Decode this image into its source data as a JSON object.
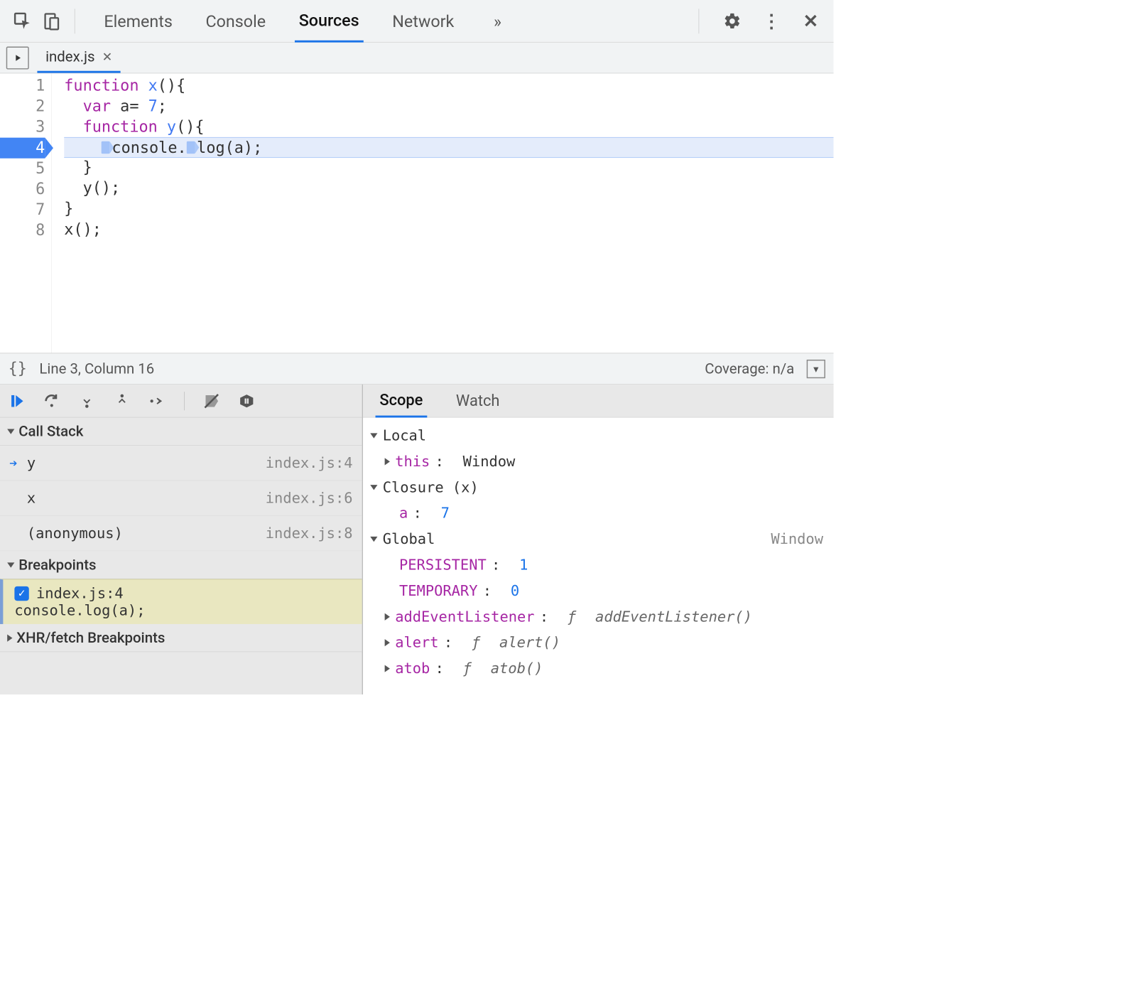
{
  "topTabs": {
    "elements": "Elements",
    "console": "Console",
    "sources": "Sources",
    "network": "Network"
  },
  "fileTab": {
    "name": "index.js"
  },
  "code": {
    "lines": [
      {
        "n": "1"
      },
      {
        "n": "2"
      },
      {
        "n": "3"
      },
      {
        "n": "4",
        "current": true
      },
      {
        "n": "5"
      },
      {
        "n": "6"
      },
      {
        "n": "7"
      },
      {
        "n": "8"
      }
    ],
    "kw_function1": "function",
    "kw_function2": "function",
    "kw_var": "var",
    "fn_x": "x",
    "fn_y": "y",
    "obj_console": "console",
    "method_log": "log",
    "arg_a": "a",
    "lit_7": "7",
    "decl_a": "a",
    "close_brace": "}",
    "call_y": "y();",
    "call_x": "x();"
  },
  "status": {
    "braces": "{}",
    "pos": "Line 3, Column 16",
    "coverage": "Coverage: n/a"
  },
  "sections": {
    "callstack": "Call Stack",
    "breakpoints": "Breakpoints",
    "xhr": "XHR/fetch Breakpoints"
  },
  "callstack": [
    {
      "name": "y",
      "loc": "index.js:4",
      "current": true
    },
    {
      "name": "x",
      "loc": "index.js:6",
      "current": false
    },
    {
      "name": "(anonymous)",
      "loc": "index.js:8",
      "current": false
    }
  ],
  "breakpoints": [
    {
      "label": "index.js:4",
      "code": "console.log(a);",
      "checked": true
    }
  ],
  "rightTabs": {
    "scope": "Scope",
    "watch": "Watch"
  },
  "scope": {
    "local": {
      "label": "Local",
      "this_key": "this",
      "this_val": "Window"
    },
    "closure": {
      "label": "Closure (x)",
      "a_key": "a",
      "a_val": "7"
    },
    "global": {
      "label": "Global",
      "right": "Window",
      "persistent_key": "PERSISTENT",
      "persistent_val": "1",
      "temporary_key": "TEMPORARY",
      "temporary_val": "0",
      "ael_key": "addEventListener",
      "ael_val_f": "ƒ",
      "ael_val_name": "addEventListener()",
      "alert_key": "alert",
      "alert_val_f": "ƒ",
      "alert_val_name": "alert()",
      "atob_key": "atob",
      "atob_val_f": "ƒ",
      "atob_val_name": "atob()"
    }
  }
}
